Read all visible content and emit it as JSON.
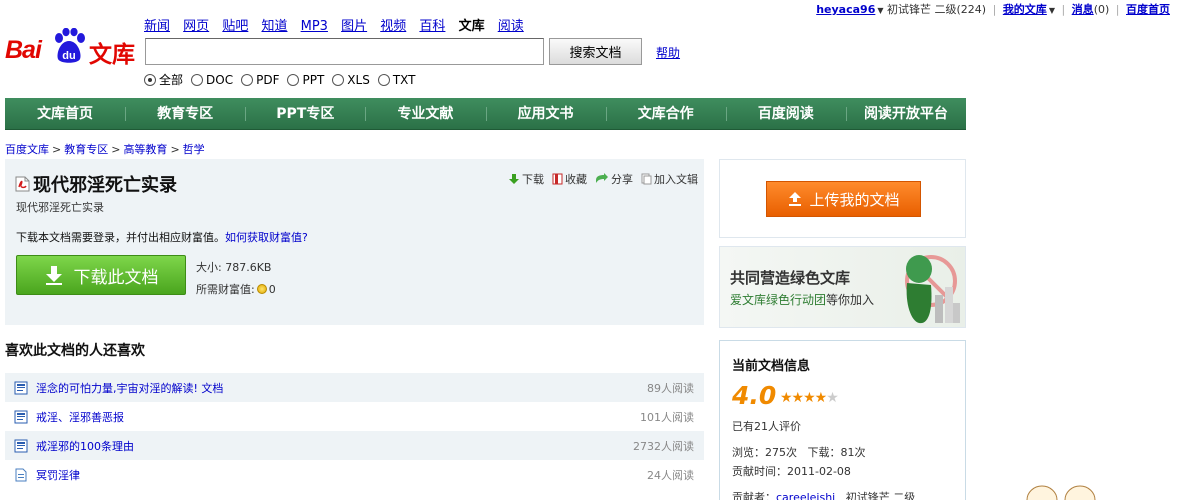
{
  "userbar": {
    "username": "heyaca96",
    "rank": "初试锋芒 二级(224)",
    "my_docs": "我的文库",
    "messages_label": "消息",
    "messages_count": "(0)",
    "home": "百度首页"
  },
  "logo": {
    "bai": "Bai",
    "du": "du",
    "wenku": "文库"
  },
  "nav": {
    "items": [
      "新闻",
      "网页",
      "贴吧",
      "知道",
      "MP3",
      "图片",
      "视频",
      "百科",
      "文库",
      "阅读"
    ]
  },
  "search": {
    "value": "",
    "button": "搜索文档",
    "help": "帮助"
  },
  "filters": [
    "全部",
    "DOC",
    "PDF",
    "PPT",
    "XLS",
    "TXT"
  ],
  "greenbar": [
    "文库首页",
    "教育专区",
    "PPT专区",
    "专业文献",
    "应用文书",
    "文库合作",
    "百度阅读",
    "阅读开放平台"
  ],
  "breadcrumb": [
    "百度文库",
    "教育专区",
    "高等教育",
    "哲学"
  ],
  "breadcrumb_sep": ">",
  "doc": {
    "title": "现代邪淫死亡实录",
    "subtitle": "现代邪淫死亡实录",
    "actions": [
      "下载",
      "收藏",
      "分享",
      "加入文辑"
    ],
    "notice": "下载本文档需要登录，并付出相应财富值。",
    "notice_link": "如何获取财富值?",
    "download_button": "下载此文档",
    "size": "大小: 787.6KB",
    "wealth_label": "所需财富值:",
    "wealth_value": "0"
  },
  "recommend": {
    "heading": "喜欢此文档的人还喜欢",
    "items": [
      {
        "title": "淫念的可怕力量,宇宙对淫的解读! 文档",
        "count": "89人阅读",
        "icon": "doc-icon"
      },
      {
        "title": "戒淫、淫邪善恶报",
        "count": "101人阅读",
        "icon": "doc-icon"
      },
      {
        "title": "戒淫邪的100条理由",
        "count": "2732人阅读",
        "icon": "doc-icon"
      },
      {
        "title": "冥罚淫律",
        "count": "24人阅读",
        "icon": "txt-icon"
      }
    ]
  },
  "upload": {
    "button": "上传我的文档"
  },
  "banner": {
    "title": "共同营造绿色文库",
    "sub_pre": "爱文库绿色行动团",
    "sub_post": "等你加入"
  },
  "info": {
    "heading": "当前文档信息",
    "score": "4.0",
    "stars_on": "★★★★",
    "stars_off": "★",
    "rated": "已有21人评价",
    "views": "浏览：275次",
    "downloads": "下载：81次",
    "time": "贡献时间：2011-02-08",
    "contrib_label": "贡献者：",
    "contributor": "careeleishi",
    "contrib_rank": "初试锋芒 二级"
  },
  "colors": {
    "baidu_red": "#e10601",
    "nav_green": "#2b7147",
    "upload_orange": "#f07000",
    "download_green": "#5cb82a",
    "link_blue": "#0000cc"
  }
}
